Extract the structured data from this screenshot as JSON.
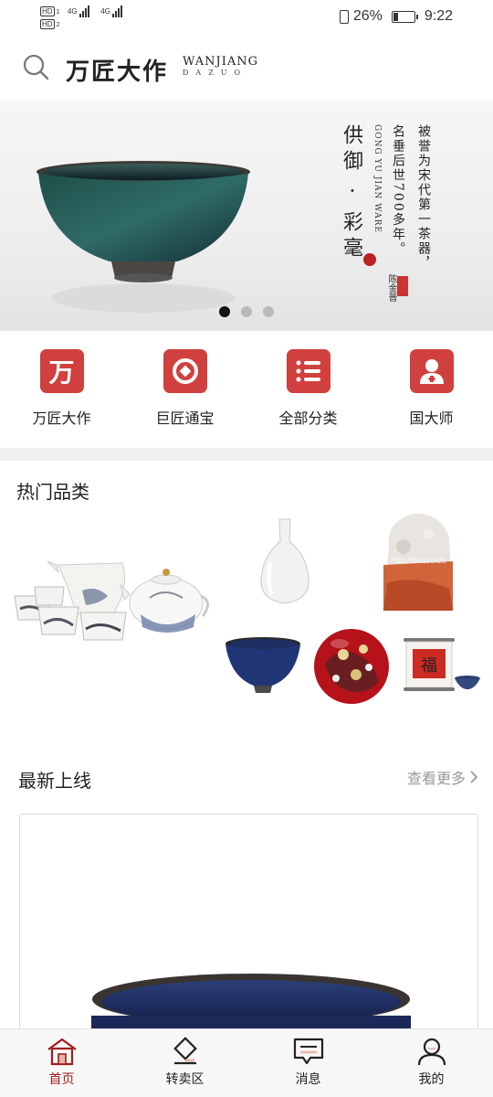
{
  "status_bar": {
    "hd1": "HD",
    "hd1_sub": "1",
    "hd2": "HD",
    "hd2_sub": "2",
    "net1": "4G",
    "net2": "4G",
    "battery": "26%",
    "battery_level_percent": 26,
    "time": "9:22"
  },
  "header": {
    "logo_cn": "万匠大作",
    "logo_en": "WANJIANG",
    "logo_en_sub": "DAZUO"
  },
  "banner": {
    "title_vertical": "供御 · 彩毫",
    "subtitle_line1": "被誉为宋代第一茶器，",
    "subtitle_line2": "名垂后世700多年。",
    "english": "GONG YU JIAN WARE",
    "signature": "陈金普",
    "page_count": 3,
    "active_index": 0
  },
  "quick_nav": [
    {
      "label": "万匠大作",
      "icon": "wan-char-icon",
      "glyph": "万"
    },
    {
      "label": "巨匠通宝",
      "icon": "coin-icon"
    },
    {
      "label": "全部分类",
      "icon": "list-icon"
    },
    {
      "label": "国大师",
      "icon": "master-icon"
    }
  ],
  "hot": {
    "title": "热门品类",
    "seal_watermark": "750x750x100x20"
  },
  "latest": {
    "title": "最新上线",
    "more_label": "查看更多"
  },
  "bottom_nav": [
    {
      "label": "首页",
      "icon": "home-icon",
      "active": true
    },
    {
      "label": "转卖区",
      "icon": "resale-icon",
      "active": false
    },
    {
      "label": "消息",
      "icon": "message-icon",
      "active": false
    },
    {
      "label": "我的",
      "icon": "profile-icon",
      "active": false
    }
  ],
  "colors": {
    "brand_red": "#d0403e",
    "active_tab": "#a31b1b"
  }
}
